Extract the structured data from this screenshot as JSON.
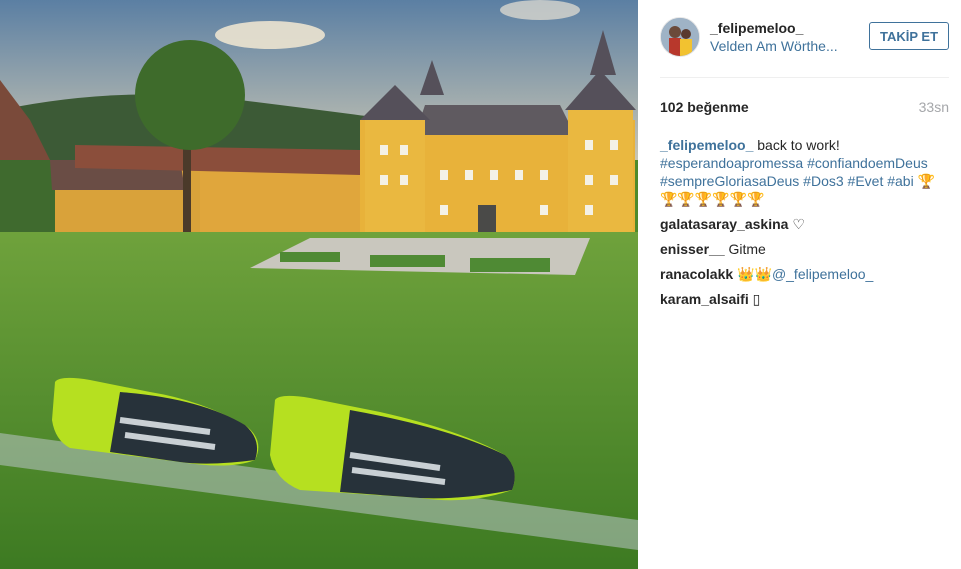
{
  "post": {
    "username": "_felipemeloo_",
    "location": "Velden Am Wörthe...",
    "follow_label": "TAKİP ET",
    "likes": "102 beğenme",
    "time_ago": "33sn"
  },
  "caption": {
    "user": "_felipemeloo_",
    "text": "back to work!",
    "hashtags_line1": "#esperandoapromessa #confiandoemDeus",
    "hashtags_line2a": "#sempreGloriasaDeus #Dos3 #Evet #abi",
    "trophy1": "🏆",
    "trophies2": "🏆🏆🏆🏆🏆🏆"
  },
  "comments": [
    {
      "user": "galatasaray_askina",
      "text": "♡"
    },
    {
      "user": "enisser__",
      "text": "Gitme"
    },
    {
      "user": "ranacolakk",
      "text": "👑👑",
      "mention": "@_felipemeloo_"
    },
    {
      "user": "karam_alsaifi",
      "text": "▯"
    }
  ],
  "colors": {
    "link": "#3f729b",
    "text": "#262626",
    "muted": "#a5a7aa",
    "grass": "#4e8a2c",
    "castle": "#e8b23a"
  }
}
